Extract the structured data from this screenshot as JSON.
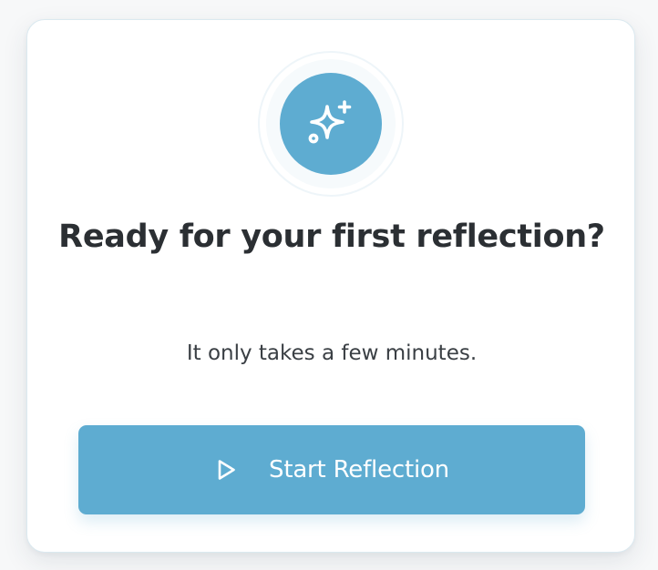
{
  "card": {
    "title": "Ready for your first reflection?",
    "subtitle": "It only takes a few minutes.",
    "icon": "sparkles-icon",
    "button": {
      "label": "Start Reflection",
      "icon": "play-icon"
    }
  },
  "colors": {
    "accent": "#5eacd1",
    "text": "#2b2f33",
    "card_background": "#ffffff"
  }
}
